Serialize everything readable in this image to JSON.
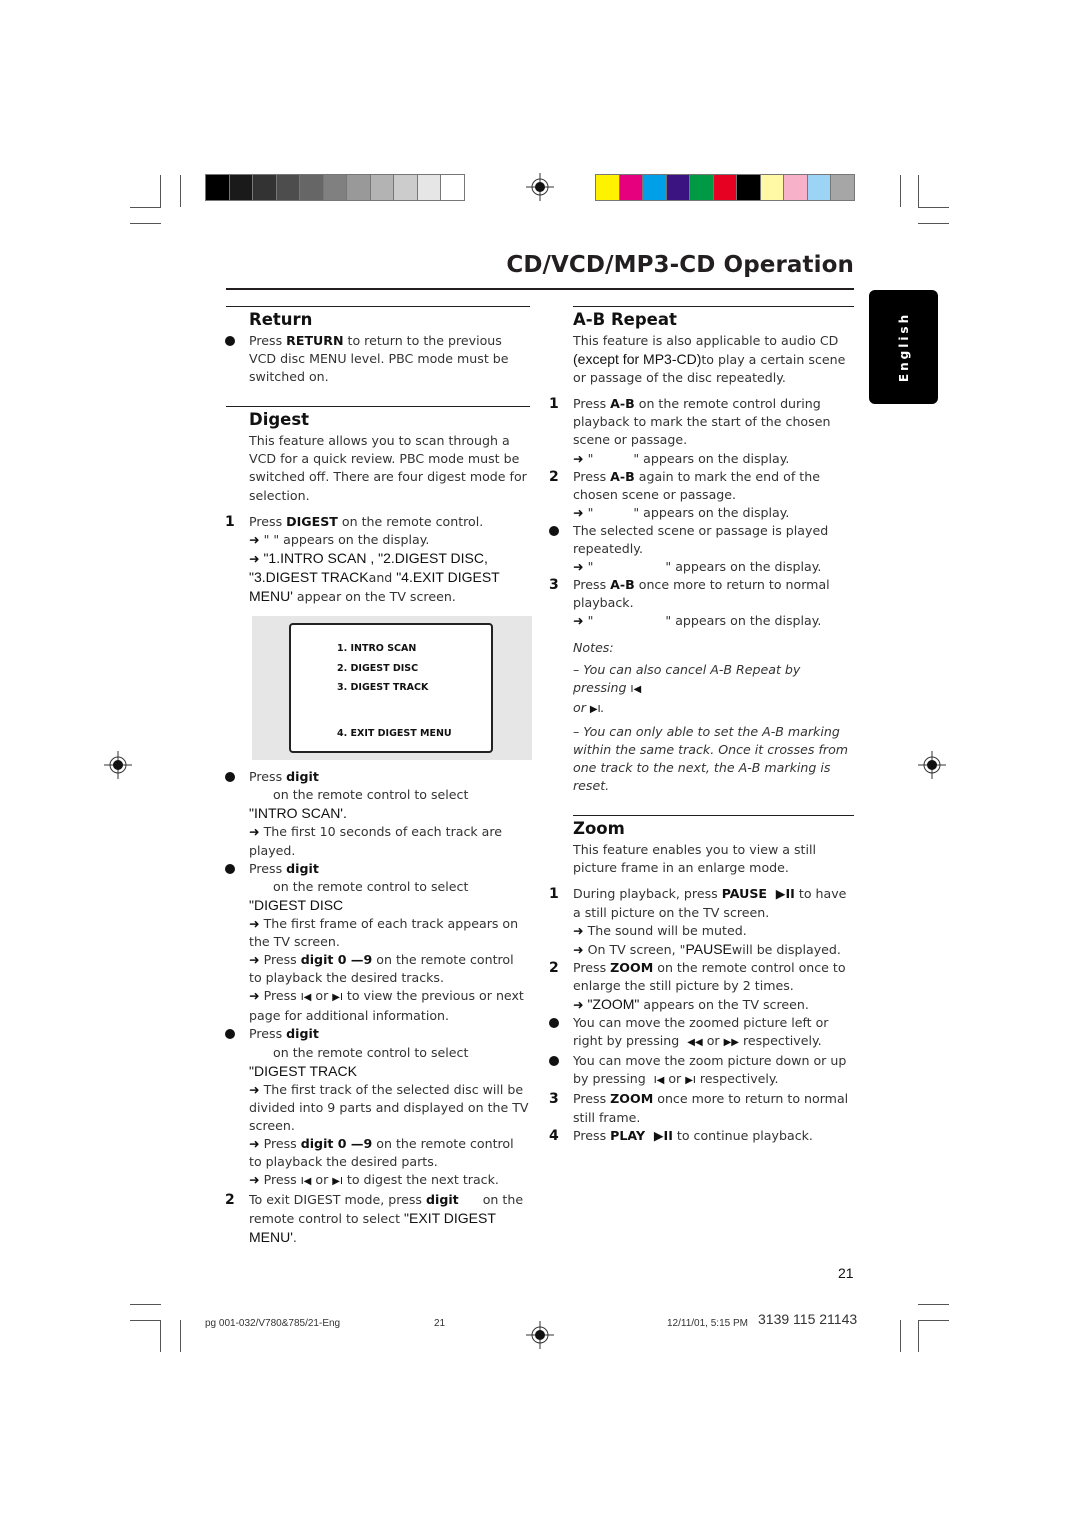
{
  "print_marks": {
    "gray_swatches": [
      "#000000",
      "#1a1a1a",
      "#333333",
      "#4d4d4d",
      "#666666",
      "#808080",
      "#999999",
      "#b3b3b3",
      "#cccccc",
      "#e6e6e6",
      "#ffffff"
    ],
    "color_swatches": [
      "#fff200",
      "#e6007e",
      "#00a0e9",
      "#3c1482",
      "#009a44",
      "#e60022",
      "#000000",
      "#fff9a6",
      "#f7b1c9",
      "#9cd4f5",
      "#a6a6a6"
    ]
  },
  "header": {
    "title": "CD/VCD/MP3-CD Operation",
    "language_tab": "English"
  },
  "left_column": {
    "return": {
      "title": "Return",
      "bullet_pre": "Press ",
      "bullet_bold": "RETURN",
      "bullet_post": " to return to the previous VCD disc MENU level.  PBC mode must be switched on."
    },
    "digest": {
      "title": "Digest",
      "intro": "This feature allows you to scan through a VCD for a quick review. PBC mode must be switched off.  There are four digest mode for selection.",
      "step1": {
        "marker": "1",
        "pre": "Press ",
        "bold": "DIGEST",
        "post": " on the remote control.",
        "result1": " \"          \" appears on the display.",
        "result2_sans": " \"1.INTRO SCAN , \"2.DIGEST DISC, \"3.DIGEST TRACK",
        "result2_and": "and",
        "result2_sans2": " \"4.EXIT DIGEST MENU'",
        "result2_post": " appear on the TV screen."
      },
      "menu_items": [
        "1.  INTRO SCAN",
        "2.  DIGEST DISC",
        "3.  DIGEST TRACK",
        "4.  EXIT DIGEST MENU"
      ],
      "bullet_intro": {
        "pre": "Press ",
        "bold": "digit",
        "post": "      on the remote control to select",
        "target": "\"INTRO SCAN'.",
        "result": " The first 10 seconds of each track are played."
      },
      "bullet_disc": {
        "pre": "Press ",
        "bold": "digit",
        "post": "      on the remote control to select",
        "target": "\"DIGEST DISC",
        "result1": " The first frame of each track appears on the TV screen.",
        "result2_pre": " Press ",
        "result2_bold": "digit 0 —9",
        "result2_post": " on the remote control to playback the desired tracks.",
        "result3_pre": " Press ",
        "result3_mid": " or ",
        "result3_post": " to view the previous or next page for additional information."
      },
      "bullet_track": {
        "pre": "Press ",
        "bold": "digit",
        "post": "      on the remote control to select",
        "target": "\"DIGEST TRACK",
        "result1": " The first track of the selected disc will be divided into 9 parts and displayed on the TV screen.",
        "result2_pre": " Press ",
        "result2_bold": "digit 0 —9",
        "result2_post": " on the remote control to playback the desired parts.",
        "result3_pre": " Press ",
        "result3_mid": " or ",
        "result3_post": " to digest the next track."
      },
      "step2": {
        "marker": "2",
        "pre": "To exit DIGEST mode, press ",
        "bold": "digit",
        "post": "      on the remote control to select ",
        "target": "\"EXIT DIGEST MENU'",
        "end": "."
      }
    }
  },
  "right_column": {
    "ab_repeat": {
      "title": "A-B Repeat",
      "intro_pre": "This feature is also applicable to audio CD ",
      "intro_sans": "(except for MP3-CD)",
      "intro_post": "to play a certain scene or passage of the disc repeatedly.",
      "step1": {
        "marker": "1",
        "pre": "Press ",
        "bold": "A-B",
        "post": " on the remote control during playback to mark the start of the chosen scene or passage.",
        "result": " \"          \" appears on the display."
      },
      "step2": {
        "marker": "2",
        "pre": "Press ",
        "bold": "A-B",
        "post": " again to mark the end of the chosen scene or passage.",
        "result": " \"          \" appears on the display."
      },
      "bullet": {
        "text": "The selected scene or passage is played repeatedly.",
        "result": " \"                  \" appears on the display."
      },
      "step3": {
        "marker": "3",
        "pre": "Press ",
        "bold": "A-B",
        "post": " once more to return to normal playback.",
        "result": " \"                  \" appears on the display."
      },
      "notes_label": "Notes:",
      "note1_pre": "–  You can also cancel A-B Repeat by pressing ",
      "note1_mid": "or ",
      "note1_end": ".",
      "note2": "–  You can only able to set the A-B marking within the same track. Once it crosses from one track to the next, the A-B marking is reset."
    },
    "zoom": {
      "title": "Zoom",
      "intro": "This feature enables you to view a still picture frame in an enlarge mode.",
      "step1": {
        "marker": "1",
        "pre": "During playback, press ",
        "bold": "PAUSE  ▶II",
        "post": " to have a still picture on the TV screen.",
        "result1": " The sound will be muted.",
        "result2_pre": " On TV screen, \"",
        "result2_sans": "PAUSE",
        "result2_post": "will be displayed."
      },
      "step2": {
        "marker": "2",
        "pre": "Press ",
        "bold": "ZOOM",
        "post": " on the remote control once to enlarge the still picture by 2 times.",
        "result_sans": " \"ZOOM\"",
        "result_post": " appears on the TV screen."
      },
      "bullet1": {
        "pre": "You can move the zoomed picture left or right by pressing  ",
        "mid": " or ",
        "post": " respectively."
      },
      "bullet2": {
        "pre": "You can move the zoom picture down or up by pressing  ",
        "mid": " or ",
        "post": " respectively."
      },
      "step3": {
        "marker": "3",
        "pre": "Press ",
        "bold": "ZOOM",
        "post": " once more to return to normal still frame."
      },
      "step4": {
        "marker": "4",
        "pre": "Press ",
        "bold": "PLAY  ▶II",
        "post": " to continue playback."
      }
    }
  },
  "icons": {
    "arrow": "➜",
    "prev": "I◀",
    "next": "▶I",
    "rewind": "◀◀",
    "forward": "▶▶"
  },
  "footer": {
    "page_number": "21",
    "slug_file": "pg 001-032/V780&785/21-Eng",
    "slug_page": "21",
    "slug_date": "12/11/01, 5:15 PM",
    "slug_code": "3139 115 21143"
  }
}
